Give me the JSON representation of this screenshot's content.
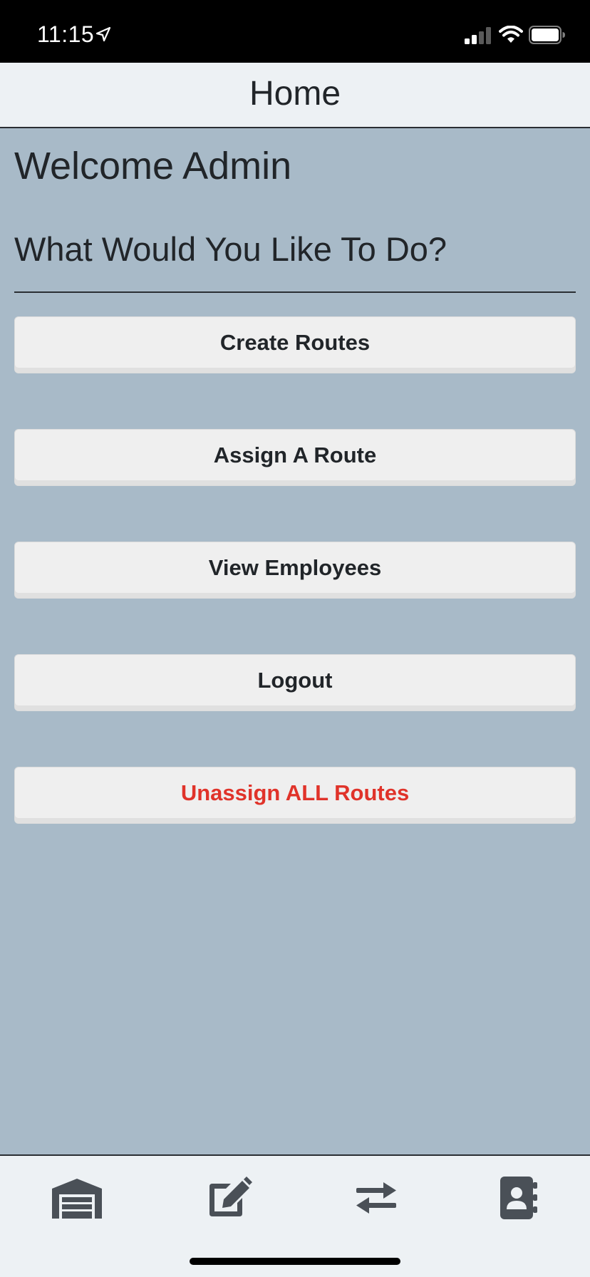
{
  "status_bar": {
    "time": "11:15",
    "icons": [
      "location-arrow-icon",
      "signal-icon",
      "wifi-icon",
      "battery-icon"
    ]
  },
  "header": {
    "title": "Home"
  },
  "main": {
    "welcome": "Welcome Admin",
    "question": "What Would You Like To Do?",
    "buttons": [
      {
        "label": "Create Routes"
      },
      {
        "label": "Assign A Route"
      },
      {
        "label": "View Employees"
      },
      {
        "label": "Logout"
      },
      {
        "label": "Unassign ALL Routes"
      }
    ]
  },
  "tab_bar": {
    "tabs": [
      {
        "icon": "warehouse-icon"
      },
      {
        "icon": "edit-icon"
      },
      {
        "icon": "exchange-arrows-icon"
      },
      {
        "icon": "contact-book-icon"
      }
    ]
  },
  "colors": {
    "background": "#a8bac8",
    "header_bg": "#edf1f4",
    "button_bg": "#efefef",
    "danger_text": "#e0332a",
    "icon_color": "#4a5057"
  }
}
